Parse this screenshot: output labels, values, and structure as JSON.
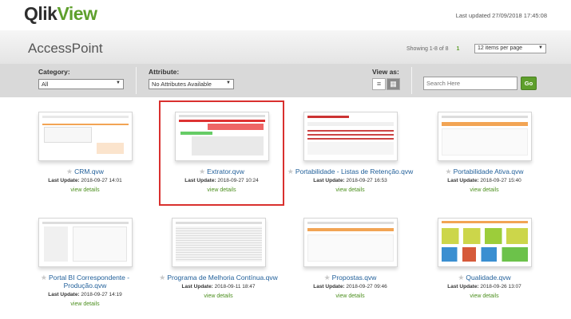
{
  "header": {
    "logo_part1": "Qlik",
    "logo_part2": "View",
    "last_updated": "Last updated 27/09/2018 17:45:08"
  },
  "title": "AccessPoint",
  "paging": {
    "showing": "Showing 1-8 of 8",
    "page": "1",
    "items_per_page": "12 items per page"
  },
  "filters": {
    "category_label": "Category:",
    "category_value": "All",
    "attribute_label": "Attribute:",
    "attribute_value": "No Attributes Available",
    "view_as_label": "View as:",
    "list_icon": "list-view-icon",
    "grid_icon": "grid-view-icon"
  },
  "search": {
    "placeholder": "Search Here",
    "go_label": "Go"
  },
  "colors": {
    "accent_green": "#5e9f2c",
    "link_blue": "#1f5e99",
    "highlight_red": "#d9302e"
  },
  "documents": [
    {
      "title": "CRM.qvw",
      "last_update_label": "Last Update:",
      "last_update": "2018-09-27 14:01",
      "view_details": "view details"
    },
    {
      "title": "Extrator.qvw",
      "last_update_label": "Last Update:",
      "last_update": "2018-09-27 10:24",
      "view_details": "view details"
    },
    {
      "title": "Portabilidade - Listas de Retenção.qvw",
      "last_update_label": "Last Update:",
      "last_update": "2018-09-27 16:53",
      "view_details": "view details"
    },
    {
      "title": "Portabilidade Ativa.qvw",
      "last_update_label": "Last Update:",
      "last_update": "2018-09-27 15:40",
      "view_details": "view details"
    },
    {
      "title": "Portal BI Correspondente - Produção.qvw",
      "last_update_label": "Last Update:",
      "last_update": "2018-09-27 14:19",
      "view_details": "view details"
    },
    {
      "title": "Programa de Melhoria Contínua.qvw",
      "last_update_label": "Last Update:",
      "last_update": "2018-09-11 18:47",
      "view_details": "view details"
    },
    {
      "title": "Propostas.qvw",
      "last_update_label": "Last Update:",
      "last_update": "2018-09-27 09:46",
      "view_details": "view details"
    },
    {
      "title": "Qualidade.qvw",
      "last_update_label": "Last Update:",
      "last_update": "2018-09-26 13:07",
      "view_details": "view details"
    }
  ]
}
